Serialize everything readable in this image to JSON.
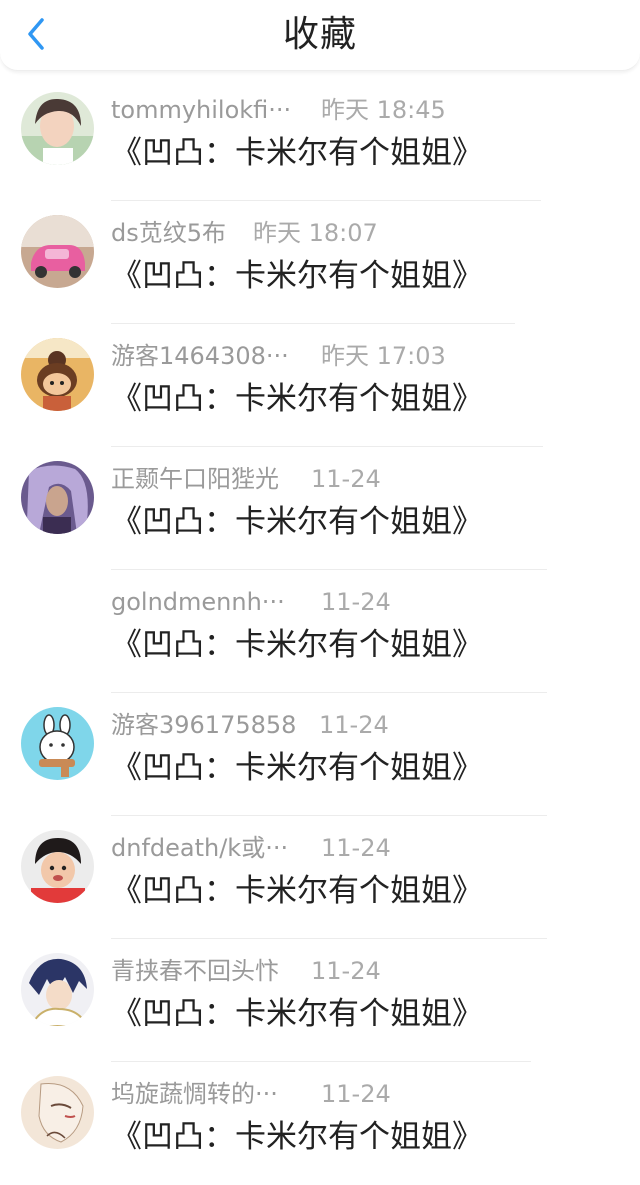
{
  "header": {
    "title": "收藏",
    "back_icon": "chevron-left-icon",
    "accent_color": "#2f97f3"
  },
  "items": [
    {
      "name": "tommyhilokfi···",
      "time": "昨天 18:45",
      "content": "《凹凸：卡米尔有个姐姐》"
    },
    {
      "name": "ds苋纹5布",
      "time": "昨天 18:07",
      "content": "《凹凸：卡米尔有个姐姐》"
    },
    {
      "name": "游客1464308···",
      "time": "昨天 17:03",
      "content": "《凹凸：卡米尔有个姐姐》"
    },
    {
      "name": "正颞午口阳狴光",
      "time": "11-24",
      "content": "《凹凸：卡米尔有个姐姐》"
    },
    {
      "name": "golndmennh···",
      "time": "11-24",
      "content": "《凹凸：卡米尔有个姐姐》"
    },
    {
      "name": "游客396175858",
      "time": "11-24",
      "content": "《凹凸：卡米尔有个姐姐》"
    },
    {
      "name": "dnfdeath/k或···",
      "time": "11-24",
      "content": "《凹凸：卡米尔有个姐姐》"
    },
    {
      "name": "青挟春不回头忭",
      "time": "11-24",
      "content": "《凹凸：卡米尔有个姐姐》"
    },
    {
      "name": "坞旋蔬惆转的···",
      "time": "11-24",
      "content": "《凹凸：卡米尔有个姐姐》"
    }
  ]
}
